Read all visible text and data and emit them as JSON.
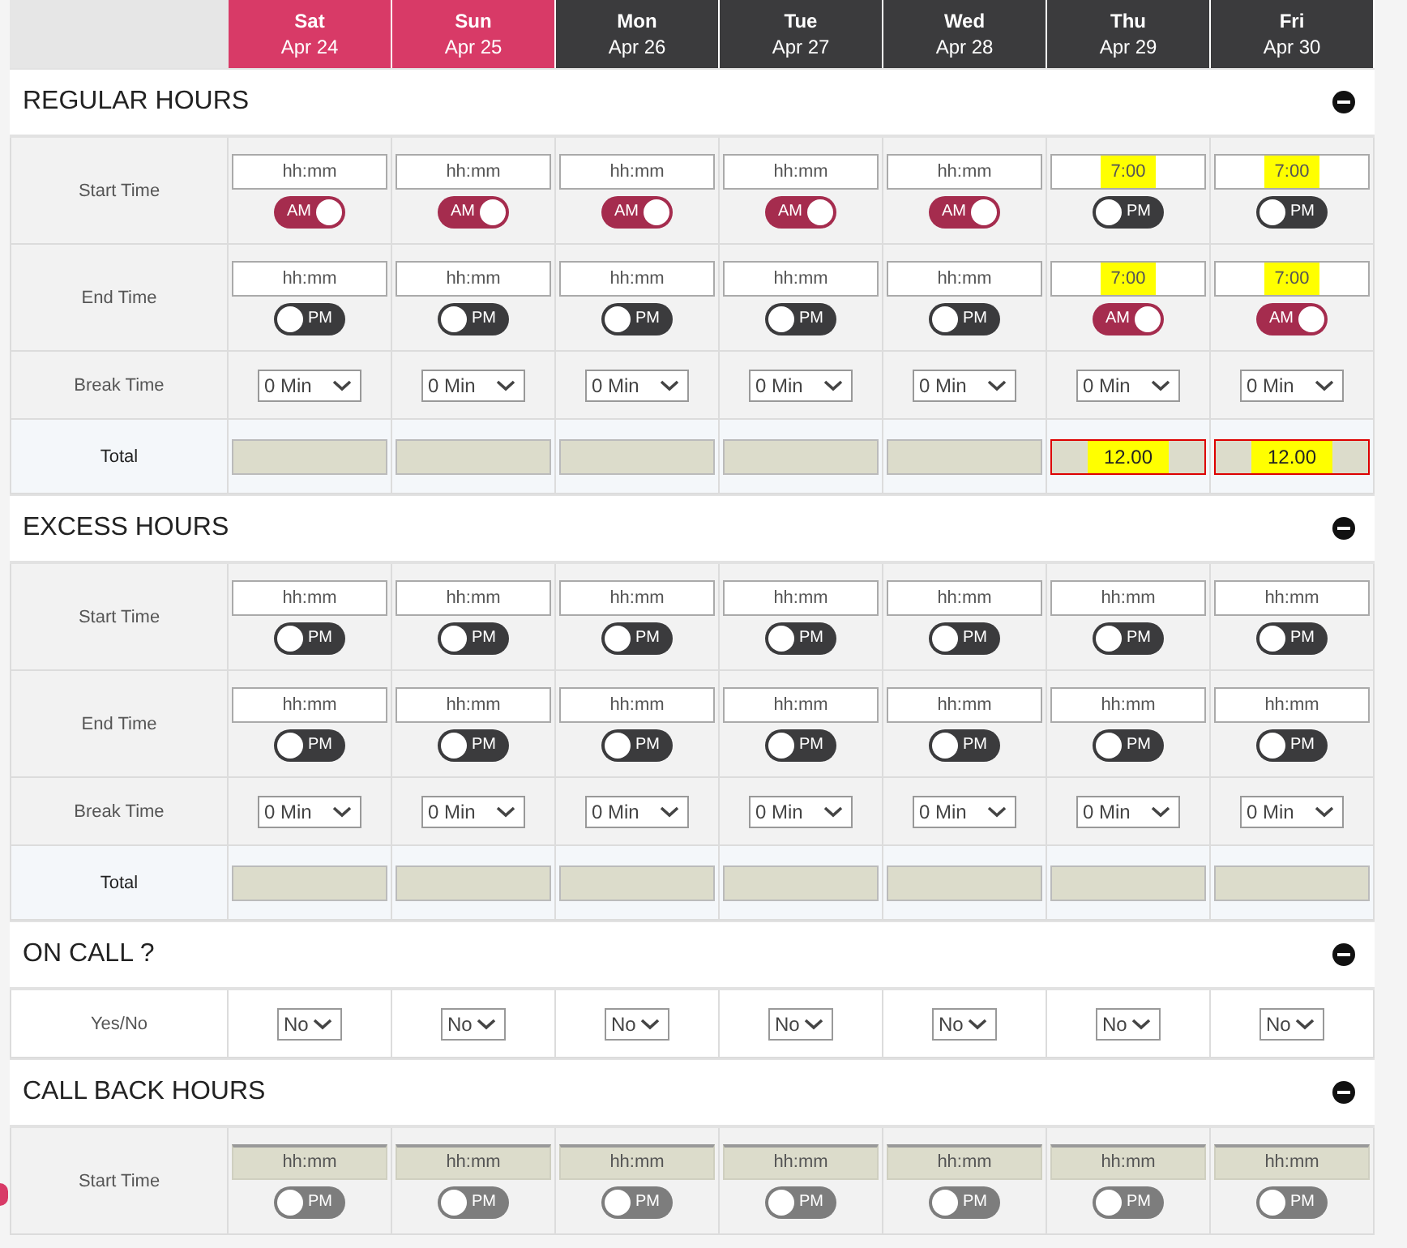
{
  "days": [
    {
      "name": "Sat",
      "date": "Apr 24",
      "weekend": true
    },
    {
      "name": "Sun",
      "date": "Apr 25",
      "weekend": true
    },
    {
      "name": "Mon",
      "date": "Apr 26",
      "weekend": false
    },
    {
      "name": "Tue",
      "date": "Apr 27",
      "weekend": false
    },
    {
      "name": "Wed",
      "date": "Apr 28",
      "weekend": false
    },
    {
      "name": "Thu",
      "date": "Apr 29",
      "weekend": false
    },
    {
      "name": "Fri",
      "date": "Apr 30",
      "weekend": false
    }
  ],
  "sections": [
    {
      "title": "REGULAR HOURS",
      "expanded": true,
      "rows": [
        {
          "kind": "time",
          "label": "Start Time",
          "cells": [
            {
              "placeholder": "hh:mm",
              "meridiem": "AM",
              "disabled": false,
              "highlighted": false
            },
            {
              "placeholder": "hh:mm",
              "meridiem": "AM",
              "disabled": false,
              "highlighted": false
            },
            {
              "placeholder": "hh:mm",
              "meridiem": "AM",
              "disabled": false,
              "highlighted": false
            },
            {
              "placeholder": "hh:mm",
              "meridiem": "AM",
              "disabled": false,
              "highlighted": false
            },
            {
              "placeholder": "hh:mm",
              "meridiem": "AM",
              "disabled": false,
              "highlighted": false
            },
            {
              "value": "7:00",
              "meridiem": "PM",
              "disabled": false,
              "highlighted": true
            },
            {
              "value": "7:00",
              "meridiem": "PM",
              "disabled": false,
              "highlighted": true
            }
          ]
        },
        {
          "kind": "time",
          "label": "End Time",
          "cells": [
            {
              "placeholder": "hh:mm",
              "meridiem": "PM",
              "disabled": false,
              "highlighted": false
            },
            {
              "placeholder": "hh:mm",
              "meridiem": "PM",
              "disabled": false,
              "highlighted": false
            },
            {
              "placeholder": "hh:mm",
              "meridiem": "PM",
              "disabled": false,
              "highlighted": false
            },
            {
              "placeholder": "hh:mm",
              "meridiem": "PM",
              "disabled": false,
              "highlighted": false
            },
            {
              "placeholder": "hh:mm",
              "meridiem": "PM",
              "disabled": false,
              "highlighted": false
            },
            {
              "value": "7:00",
              "meridiem": "AM",
              "disabled": false,
              "highlighted": true
            },
            {
              "value": "7:00",
              "meridiem": "AM",
              "disabled": false,
              "highlighted": true
            }
          ]
        },
        {
          "kind": "select",
          "label": "Break Time",
          "cells": [
            {
              "value": "0 Min"
            },
            {
              "value": "0 Min"
            },
            {
              "value": "0 Min"
            },
            {
              "value": "0 Min"
            },
            {
              "value": "0 Min"
            },
            {
              "value": "0 Min"
            },
            {
              "value": "0 Min"
            }
          ]
        },
        {
          "kind": "total",
          "label": "Total",
          "cells": [
            {
              "error": false
            },
            {
              "error": false
            },
            {
              "error": false
            },
            {
              "error": false
            },
            {
              "error": false
            },
            {
              "value": "12.00",
              "error": true,
              "highlighted": true
            },
            {
              "value": "12.00",
              "error": true,
              "highlighted": true
            }
          ]
        }
      ]
    },
    {
      "title": "EXCESS HOURS",
      "expanded": true,
      "rows": [
        {
          "kind": "time",
          "label": "Start Time",
          "cells": [
            {
              "placeholder": "hh:mm",
              "meridiem": "PM",
              "disabled": false,
              "highlighted": false
            },
            {
              "placeholder": "hh:mm",
              "meridiem": "PM",
              "disabled": false,
              "highlighted": false
            },
            {
              "placeholder": "hh:mm",
              "meridiem": "PM",
              "disabled": false,
              "highlighted": false
            },
            {
              "placeholder": "hh:mm",
              "meridiem": "PM",
              "disabled": false,
              "highlighted": false
            },
            {
              "placeholder": "hh:mm",
              "meridiem": "PM",
              "disabled": false,
              "highlighted": false
            },
            {
              "placeholder": "hh:mm",
              "meridiem": "PM",
              "disabled": false,
              "highlighted": false
            },
            {
              "placeholder": "hh:mm",
              "meridiem": "PM",
              "disabled": false,
              "highlighted": false
            }
          ]
        },
        {
          "kind": "time",
          "label": "End Time",
          "cells": [
            {
              "placeholder": "hh:mm",
              "meridiem": "PM",
              "disabled": false,
              "highlighted": false
            },
            {
              "placeholder": "hh:mm",
              "meridiem": "PM",
              "disabled": false,
              "highlighted": false
            },
            {
              "placeholder": "hh:mm",
              "meridiem": "PM",
              "disabled": false,
              "highlighted": false
            },
            {
              "placeholder": "hh:mm",
              "meridiem": "PM",
              "disabled": false,
              "highlighted": false
            },
            {
              "placeholder": "hh:mm",
              "meridiem": "PM",
              "disabled": false,
              "highlighted": false
            },
            {
              "placeholder": "hh:mm",
              "meridiem": "PM",
              "disabled": false,
              "highlighted": false
            },
            {
              "placeholder": "hh:mm",
              "meridiem": "PM",
              "disabled": false,
              "highlighted": false
            }
          ]
        },
        {
          "kind": "select",
          "label": "Break Time",
          "cells": [
            {
              "value": "0 Min"
            },
            {
              "value": "0 Min"
            },
            {
              "value": "0 Min"
            },
            {
              "value": "0 Min"
            },
            {
              "value": "0 Min"
            },
            {
              "value": "0 Min"
            },
            {
              "value": "0 Min"
            }
          ]
        },
        {
          "kind": "total",
          "label": "Total",
          "cells": [
            {
              "error": false
            },
            {
              "error": false
            },
            {
              "error": false
            },
            {
              "error": false
            },
            {
              "error": false
            },
            {
              "error": false
            },
            {
              "error": false
            }
          ]
        }
      ]
    },
    {
      "title": "ON CALL ?",
      "expanded": true,
      "rows": [
        {
          "kind": "yesno",
          "label": "Yes/No",
          "cells": [
            {
              "value": "No"
            },
            {
              "value": "No"
            },
            {
              "value": "No"
            },
            {
              "value": "No"
            },
            {
              "value": "No"
            },
            {
              "value": "No"
            },
            {
              "value": "No"
            }
          ]
        }
      ]
    },
    {
      "title": "CALL BACK HOURS",
      "expanded": true,
      "rows": [
        {
          "kind": "time",
          "label": "Start Time",
          "cells": [
            {
              "placeholder": "hh:mm",
              "meridiem": "PM",
              "disabled": true,
              "highlighted": false
            },
            {
              "placeholder": "hh:mm",
              "meridiem": "PM",
              "disabled": true,
              "highlighted": false
            },
            {
              "placeholder": "hh:mm",
              "meridiem": "PM",
              "disabled": true,
              "highlighted": false
            },
            {
              "placeholder": "hh:mm",
              "meridiem": "PM",
              "disabled": true,
              "highlighted": false
            },
            {
              "placeholder": "hh:mm",
              "meridiem": "PM",
              "disabled": true,
              "highlighted": false
            },
            {
              "placeholder": "hh:mm",
              "meridiem": "PM",
              "disabled": true,
              "highlighted": false
            },
            {
              "placeholder": "hh:mm",
              "meridiem": "PM",
              "disabled": true,
              "highlighted": false
            }
          ]
        }
      ]
    }
  ]
}
